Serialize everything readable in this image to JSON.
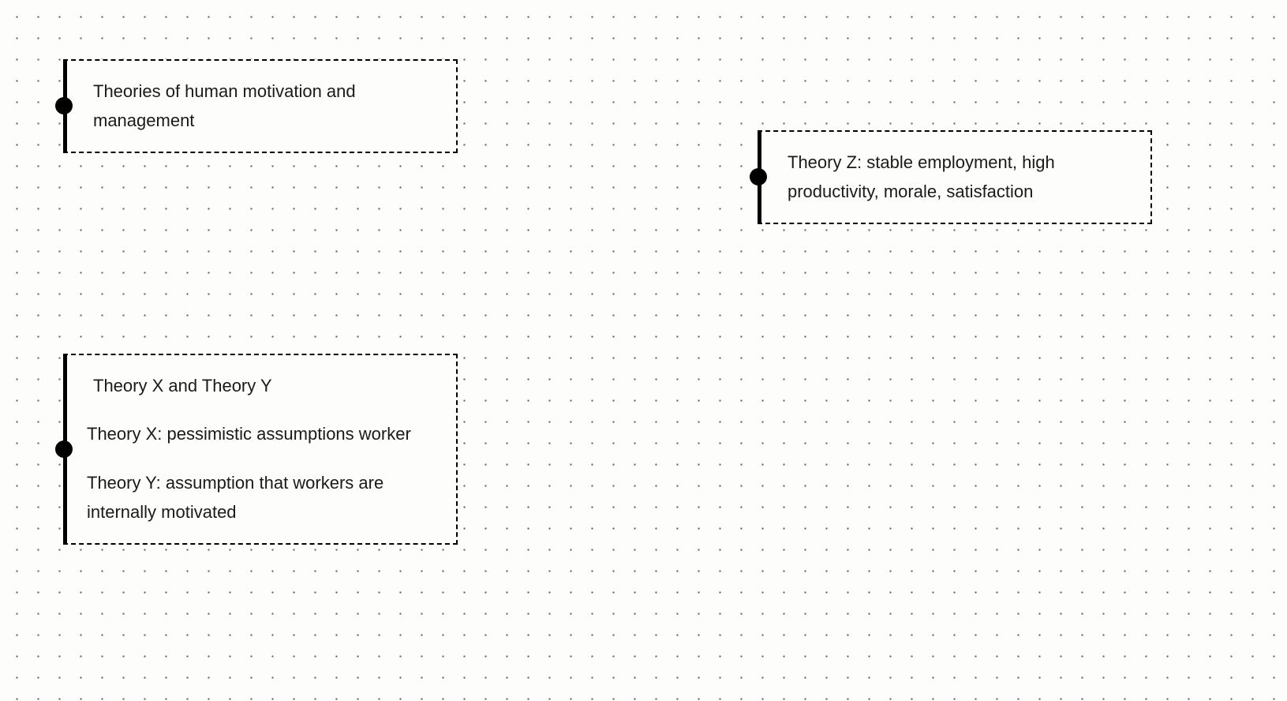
{
  "cards": [
    {
      "id": "card1",
      "lines": [
        {
          "text": "Theories of human motivation and management",
          "indent": true
        }
      ]
    },
    {
      "id": "card2",
      "lines": [
        {
          "text": "Theory Z: stable employment, high productivity, morale, satisfaction",
          "indent": true
        }
      ]
    },
    {
      "id": "card3",
      "lines": [
        {
          "text": "Theory X and Theory Y",
          "indent": true
        },
        {
          "text": "Theory X: pessimistic assumptions worker",
          "indent": false
        },
        {
          "text": "Theory Y: assumption that workers are internally motivated",
          "indent": false
        }
      ]
    }
  ]
}
